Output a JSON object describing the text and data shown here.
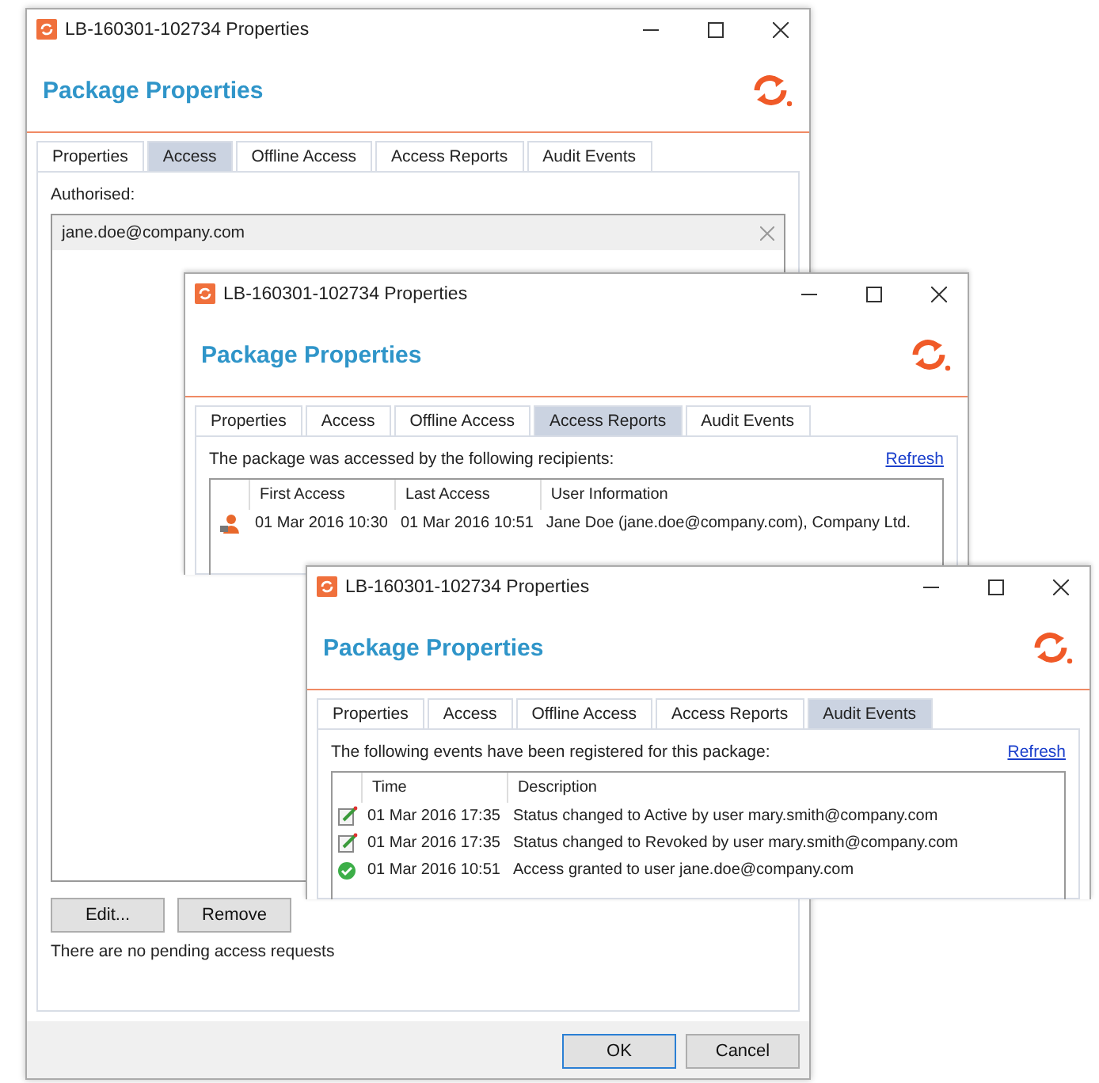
{
  "windows": [
    {
      "kind": "access",
      "title": "LB-160301-102734 Properties",
      "header": "Package Properties",
      "tabs": [
        {
          "label": "Properties",
          "selected": false
        },
        {
          "label": "Access",
          "selected": true
        },
        {
          "label": "Offline Access",
          "selected": false
        },
        {
          "label": "Access Reports",
          "selected": false
        },
        {
          "label": "Audit Events",
          "selected": false
        }
      ],
      "list_label": "Authorised:",
      "list_items": [
        "jane.doe@company.com"
      ],
      "list_buttons": [
        "Edit...",
        "Remove"
      ],
      "note": "There are no pending access requests",
      "footer_buttons": [
        {
          "label": "OK",
          "default": true
        },
        {
          "label": "Cancel",
          "default": false
        }
      ]
    },
    {
      "kind": "access_reports",
      "title": "LB-160301-102734 Properties",
      "header": "Package Properties",
      "tabs": [
        {
          "label": "Properties",
          "selected": false
        },
        {
          "label": "Access",
          "selected": false
        },
        {
          "label": "Offline Access",
          "selected": false
        },
        {
          "label": "Access Reports",
          "selected": true
        },
        {
          "label": "Audit Events",
          "selected": false
        }
      ],
      "intro": "The package was accessed by the following recipients:",
      "refresh": "Refresh",
      "columns": [
        "First Access",
        "Last Access",
        "User Information"
      ],
      "rows": [
        {
          "kind": "person",
          "cells": [
            "01 Mar 2016 10:30",
            "01 Mar 2016 10:51",
            "Jane Doe (jane.doe@company.com), Company Ltd."
          ]
        }
      ]
    },
    {
      "kind": "audit_events",
      "title": "LB-160301-102734 Properties",
      "header": "Package Properties",
      "tabs": [
        {
          "label": "Properties",
          "selected": false
        },
        {
          "label": "Access",
          "selected": false
        },
        {
          "label": "Offline Access",
          "selected": false
        },
        {
          "label": "Access Reports",
          "selected": false
        },
        {
          "label": "Audit Events",
          "selected": true
        }
      ],
      "intro": "The following events have been registered for this package:",
      "refresh": "Refresh",
      "columns": [
        "Time",
        "Description"
      ],
      "rows": [
        {
          "kind": "edit",
          "cells": [
            "01 Mar 2016 17:35",
            "Status changed to Active by user mary.smith@company.com"
          ]
        },
        {
          "kind": "edit",
          "cells": [
            "01 Mar 2016 17:35",
            "Status changed to Revoked by user mary.smith@company.com"
          ]
        },
        {
          "kind": "granted",
          "cells": [
            "01 Mar 2016 10:51",
            "Access granted to user jane.doe@company.com"
          ]
        }
      ]
    }
  ]
}
